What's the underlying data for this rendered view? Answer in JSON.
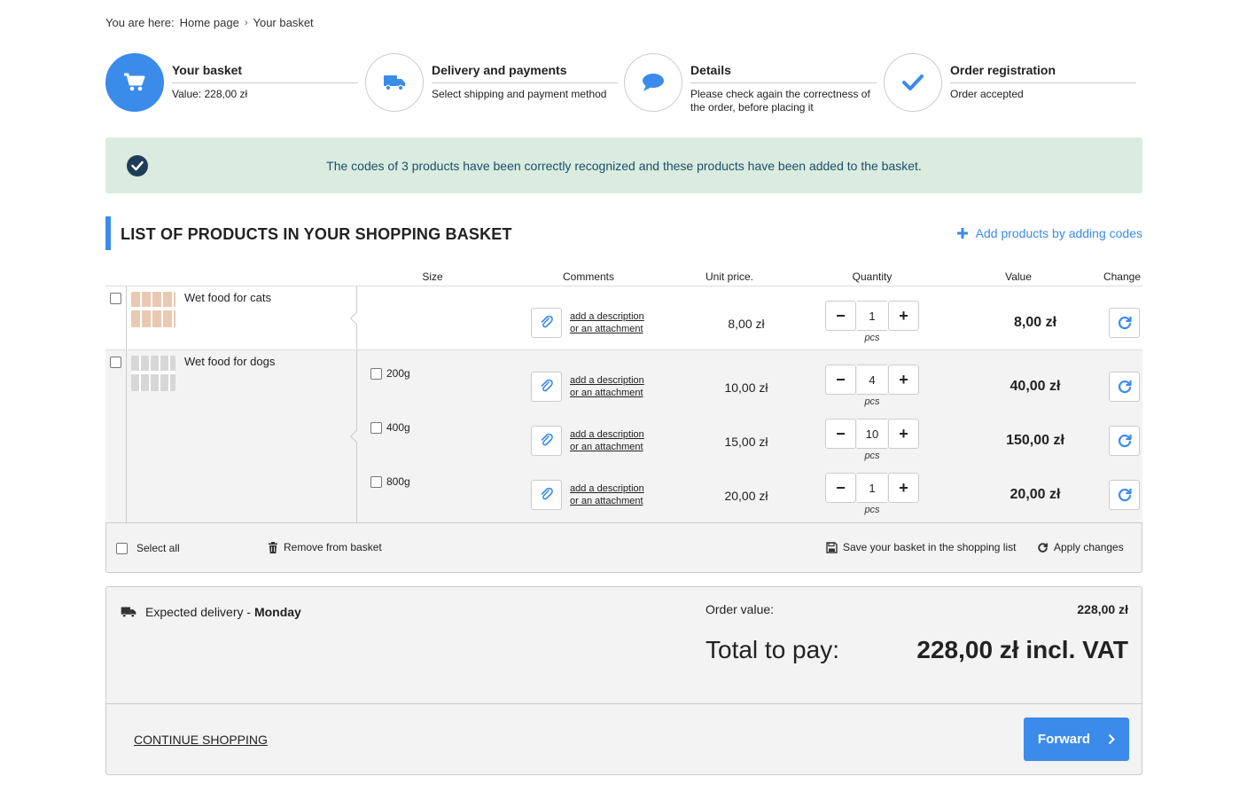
{
  "breadcrumb": {
    "prefix": "You are here:",
    "home": "Home page",
    "current": "Your basket"
  },
  "steps": [
    {
      "title": "Your basket",
      "subtitle": "Value: 228,00 zł",
      "icon": "cart-icon"
    },
    {
      "title": "Delivery and payments",
      "subtitle": "Select shipping and payment method",
      "icon": "truck-icon"
    },
    {
      "title": "Details",
      "subtitle": "Please check again the correctness of the order, before placing it",
      "icon": "speech-bubble-icon"
    },
    {
      "title": "Order registration",
      "subtitle": "Order accepted",
      "icon": "checkmark-icon"
    }
  ],
  "alert": {
    "message": "The codes of 3 products have been correctly recognized and these products have been added to the basket."
  },
  "section": {
    "title": "LIST OF PRODUCTS IN YOUR SHOPPING BASKET",
    "add_codes": "Add products by adding codes"
  },
  "columns": {
    "size": "Size",
    "comments": "Comments",
    "unit_price": "Unit price.",
    "quantity": "Quantity",
    "value": "Value",
    "change": "Change"
  },
  "comment_link": {
    "line1": "add a description",
    "line2": "or an attachment"
  },
  "unit": "pcs",
  "products": [
    {
      "name": "Wet food for cats",
      "variants": [
        {
          "size": "",
          "unit_price": "8,00 zł",
          "quantity": "1",
          "value": "8,00 zł"
        }
      ]
    },
    {
      "name": "Wet food for dogs",
      "variants": [
        {
          "size": "200g",
          "unit_price": "10,00 zł",
          "quantity": "4",
          "value": "40,00 zł"
        },
        {
          "size": "400g",
          "unit_price": "15,00 zł",
          "quantity": "10",
          "value": "150,00 zł"
        },
        {
          "size": "800g",
          "unit_price": "20,00 zł",
          "quantity": "1",
          "value": "20,00 zł"
        }
      ]
    }
  ],
  "footer": {
    "select_all": "Select all",
    "remove": "Remove from basket",
    "save_list": "Save your basket in the shopping list",
    "apply": "Apply changes"
  },
  "summary": {
    "delivery_label": "Expected delivery - ",
    "delivery_day": "Monday",
    "order_value_label": "Order value:",
    "order_value": "228,00 zł",
    "total_label": "Total to pay:",
    "total_value": "228,00 zł incl. VAT",
    "continue": "CONTINUE SHOPPING",
    "forward": "Forward"
  },
  "colors": {
    "accent": "#3b8beb",
    "alert_bg": "#d9ecdf",
    "alert_text": "#1f4b6b"
  }
}
